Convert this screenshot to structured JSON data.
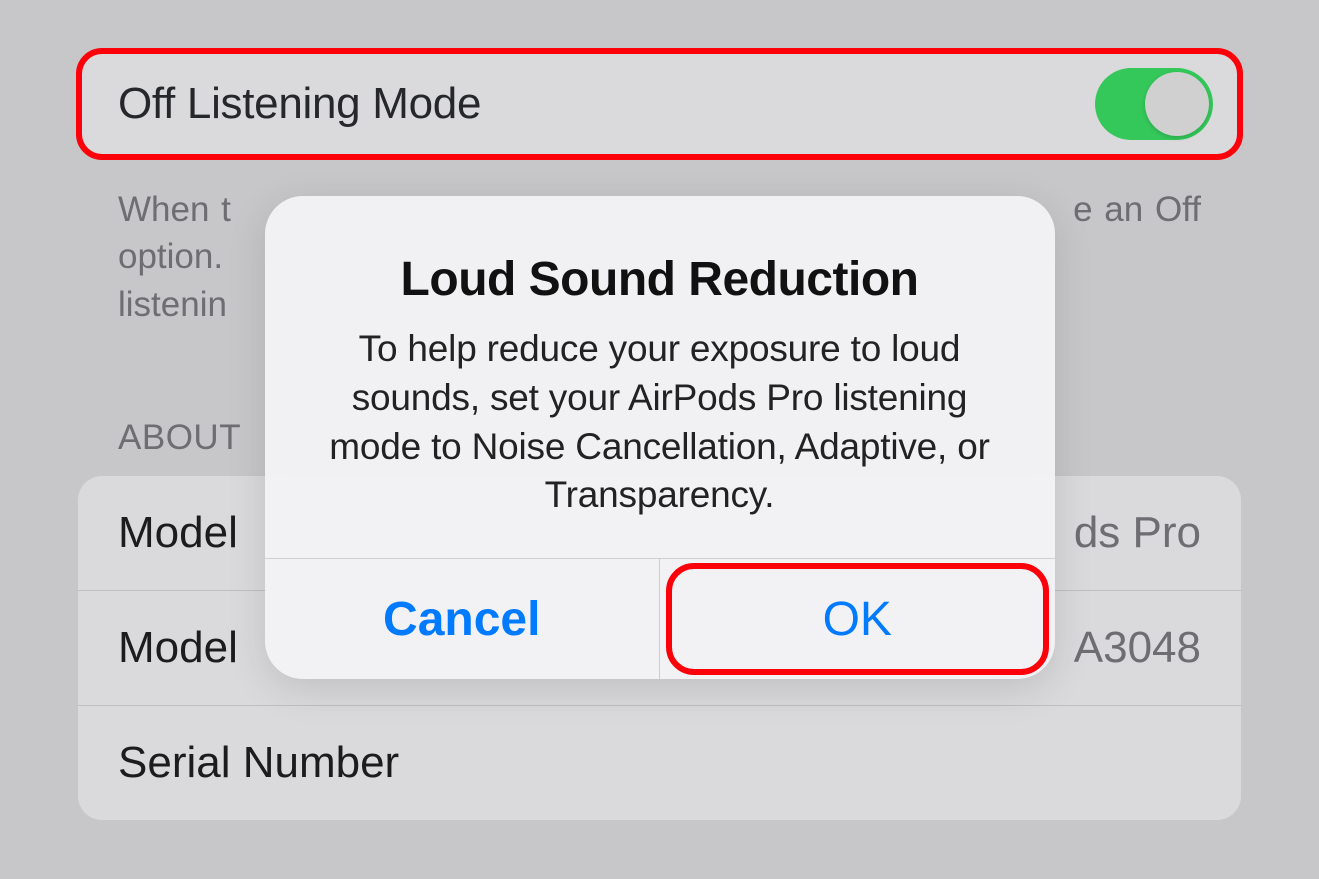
{
  "settings": {
    "off_listening_mode": {
      "label": "Off Listening Mode",
      "enabled": true
    },
    "footer_line1": "When t",
    "footer_line1_tail": "e an Off",
    "footer_line2": "option.",
    "footer_line3": "listenin"
  },
  "about": {
    "header": "ABOUT",
    "rows": [
      {
        "key_visible": "Model",
        "value_tail": "ds Pro"
      },
      {
        "key_visible": "Model",
        "value_tail": "A3048"
      },
      {
        "key_visible": "Serial Number",
        "value_tail": ""
      }
    ]
  },
  "alert": {
    "title": "Loud Sound Reduction",
    "message": "To help reduce your exposure to loud sounds, set your AirPods Pro listening mode to Noise Cancellation, Adaptive, or Transparency.",
    "cancel": "Cancel",
    "ok": "OK"
  },
  "annotations": {
    "toggle_highlight": true,
    "ok_highlight": true
  }
}
